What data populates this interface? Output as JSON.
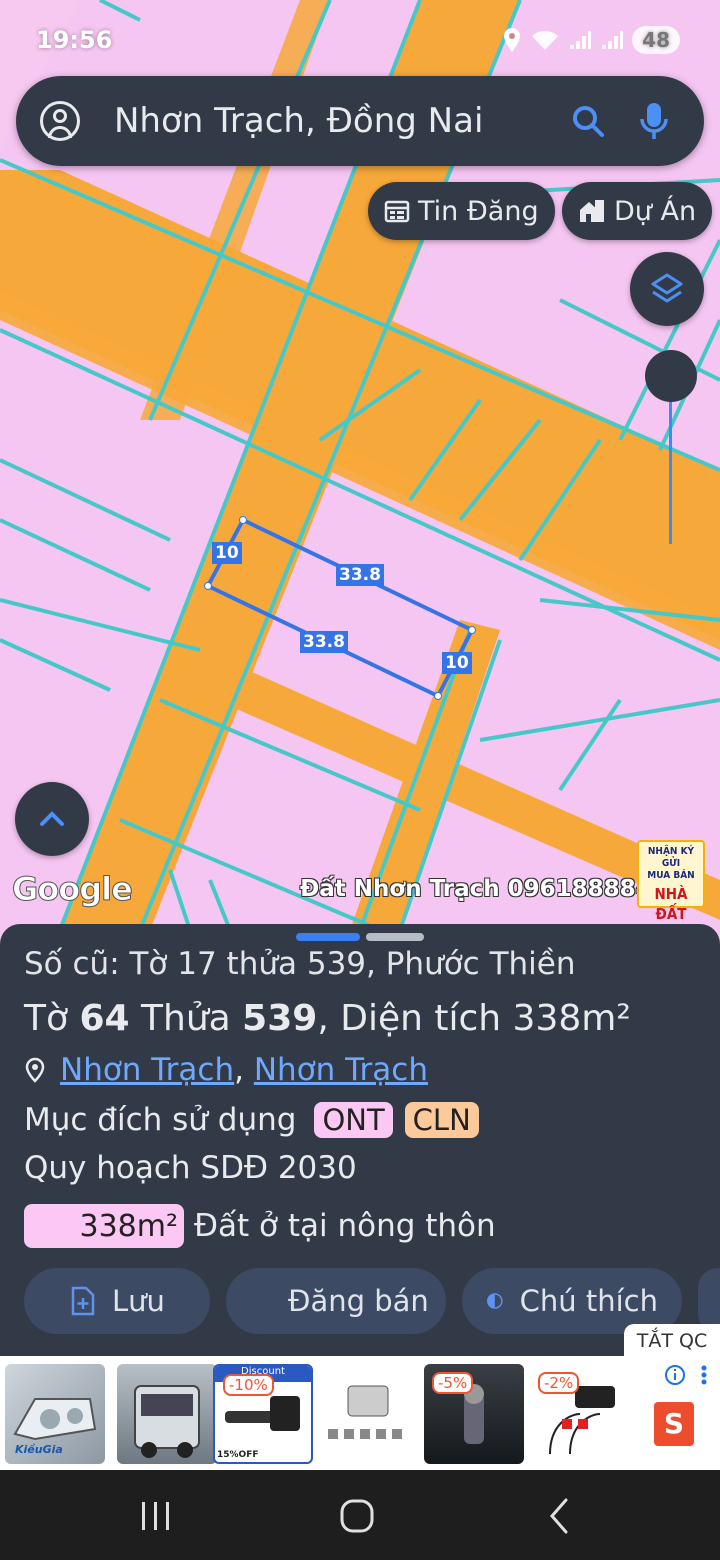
{
  "status_bar": {
    "time": "19:56",
    "battery": "48"
  },
  "search": {
    "query": "Nhơn Trạch, Đồng Nai"
  },
  "chips": {
    "listings": "Tin Đăng",
    "projects": "Dự Án"
  },
  "map": {
    "edge_lengths": {
      "left": "10",
      "top": "33.8",
      "bottom": "33.8",
      "right": "10"
    },
    "attribution": "Google",
    "watermark": "Đất Nhơn Trạch 0961888848",
    "ad_logo": {
      "line1": "NHẬN KÝ GỬI",
      "line2": "MUA BÁN",
      "line3": "NHÀ ĐẤT"
    },
    "colors": {
      "residential": "#f7c8f0",
      "perennial": "#f7a83a",
      "boundary": "#46c8c8",
      "parcel_outline": "#3574e6"
    }
  },
  "sheet": {
    "old_ref": "Số cũ: Tờ 17 thửa 539, Phước Thiền",
    "parcel": {
      "sheet_label": "Tờ",
      "sheet_no": "64",
      "plot_label": "Thửa",
      "plot_no": "539",
      "area_label": "Diện tích",
      "area": "338m²"
    },
    "location": {
      "district": "Nhơn Trạch",
      "separator": ",",
      "commune": "Nhơn Trạch"
    },
    "purpose_label": "Mục đích sử dụng",
    "purpose_tags": [
      {
        "code": "ONT",
        "color": "#fbc8f4"
      },
      {
        "code": "CLN",
        "color": "#fbc99a"
      }
    ],
    "planning": "Quy hoạch SDĐ 2030",
    "planning_row": {
      "area": "338m²",
      "description": "Đất ở tại nông thôn"
    },
    "actions": {
      "save": "Lưu",
      "post_sale": "Đăng bán",
      "legend": "Chú thích"
    }
  },
  "ad": {
    "close_label": "TẮT QC",
    "discounts": [
      "-10%",
      "-5%",
      "-2%"
    ],
    "first_brand": "KiềuGia",
    "third_header": "Discount",
    "third_footer": "15%OFF",
    "shop_letter": "S"
  }
}
